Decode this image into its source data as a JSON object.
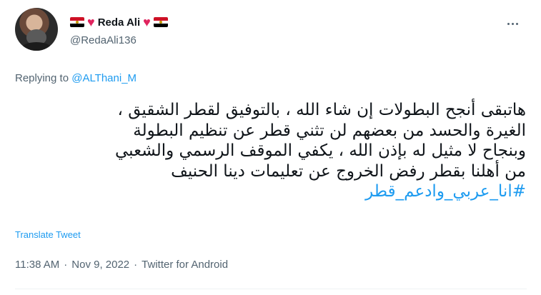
{
  "author": {
    "name": "Reda Ali",
    "handle": "@RedaAli136"
  },
  "reply": {
    "prefix": "Replying to",
    "to": "@ALThani_M"
  },
  "tweet": {
    "lines": [
      "هاتبقى أنجح البطولات إن شاء الله ، بالتوفيق لقطر الشقيق ،",
      "الغيرة والحسد من بعضهم لن تثني قطر عن تنظيم البطولة",
      "وبنجاح لا مثيل له بإذن الله ، يكفي الموقف الرسمي والشعبي",
      "من أهلنا بقطر رفض الخروج عن تعليمات دينا الحنيف"
    ],
    "hashtag": "#انا_عربي_وادعم_قطر"
  },
  "translate_label": "Translate Tweet",
  "meta": {
    "time": "11:38 AM",
    "separator1": "·",
    "date": "Nov 9, 2022",
    "separator2": "·",
    "source": "Twitter for Android"
  },
  "colors": {
    "link": "#1d9bf0",
    "secondary_text": "#536471",
    "heart": "#e0245e"
  },
  "icons": [
    "egypt-flag-icon",
    "heart-icon",
    "more-icon"
  ]
}
